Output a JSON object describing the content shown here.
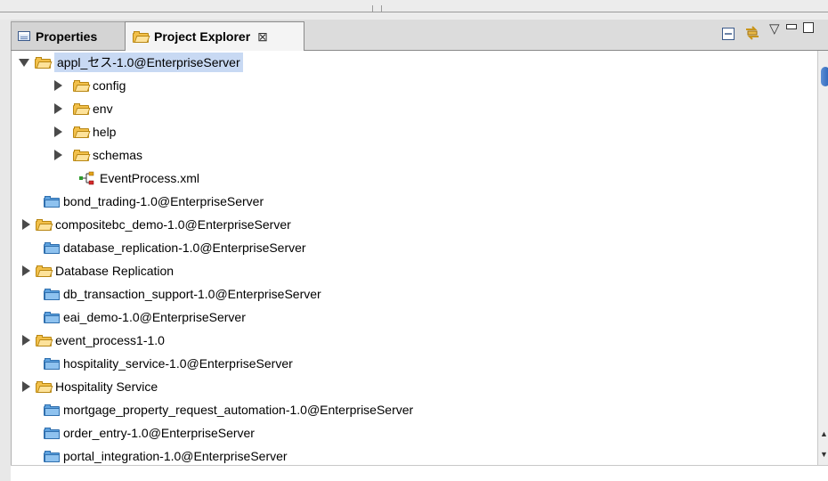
{
  "tabs": {
    "properties_label": "Properties",
    "explorer_label": "Project Explorer",
    "close_glyph": "⊠"
  },
  "toolbar": {
    "collapse_icon": "collapse-all-icon",
    "link_icon": "link-with-editor-icon",
    "menu_glyph": "▽",
    "minimize_glyph": "▭",
    "maximize_glyph": "▭"
  },
  "tree": {
    "root": {
      "label": "appl_セス-1.0@EnterpriseServer",
      "expanded": true,
      "selected": true
    },
    "children": [
      {
        "label": "config",
        "type": "folder"
      },
      {
        "label": "env",
        "type": "folder"
      },
      {
        "label": "help",
        "type": "folder"
      },
      {
        "label": "schemas",
        "type": "folder"
      },
      {
        "label": "EventProcess.xml",
        "type": "xml"
      }
    ],
    "items": [
      {
        "label": "bond_trading-1.0@EnterpriseServer",
        "type": "project"
      },
      {
        "label": "compositebc_demo-1.0@EnterpriseServer",
        "type": "folder"
      },
      {
        "label": "database_replication-1.0@EnterpriseServer",
        "type": "project"
      },
      {
        "label": "Database Replication",
        "type": "folder"
      },
      {
        "label": "db_transaction_support-1.0@EnterpriseServer",
        "type": "project"
      },
      {
        "label": "eai_demo-1.0@EnterpriseServer",
        "type": "project"
      },
      {
        "label": "event_process1-1.0",
        "type": "folder"
      },
      {
        "label": "hospitality_service-1.0@EnterpriseServer",
        "type": "project"
      },
      {
        "label": "Hospitality Service",
        "type": "folder"
      },
      {
        "label": "mortgage_property_request_automation-1.0@EnterpriseServer",
        "type": "project"
      },
      {
        "label": "order_entry-1.0@EnterpriseServer",
        "type": "project"
      },
      {
        "label": "portal_integration-1.0@EnterpriseServer",
        "type": "project"
      }
    ]
  },
  "colors": {
    "selection": "#c8d9f3",
    "folder": "#f2c04a",
    "project_folder": "#5ea2df",
    "scroll_thumb": "#2a63b8"
  }
}
